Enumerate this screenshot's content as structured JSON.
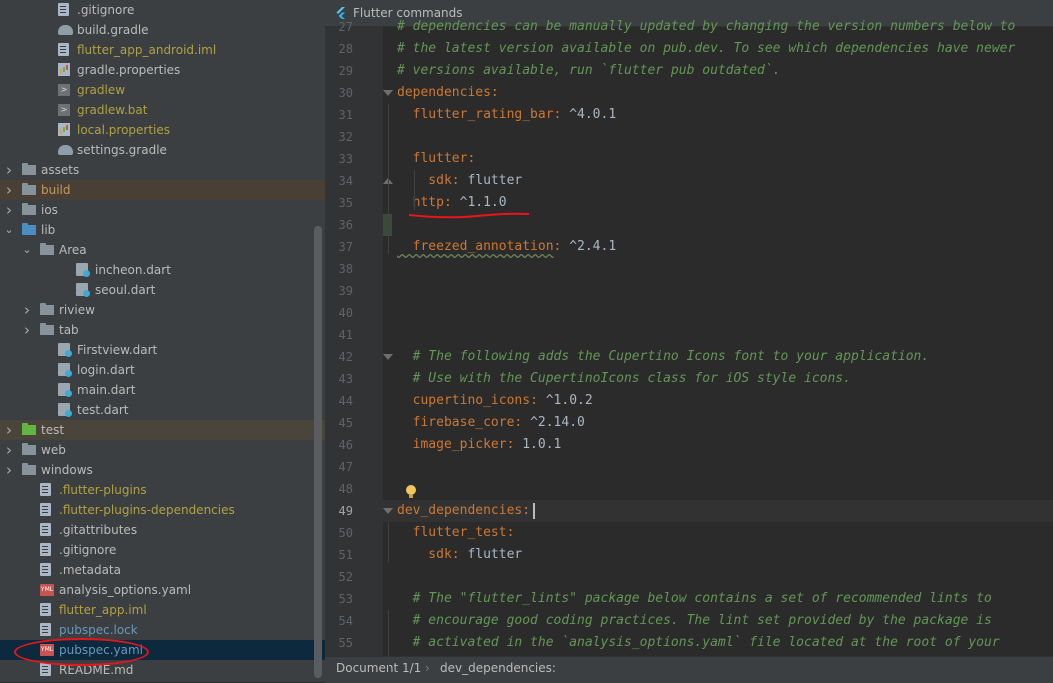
{
  "tree": {
    "items": [
      {
        "label": ".gitignore",
        "color": "def",
        "icon": "gitignore-file-icon",
        "depth": 2
      },
      {
        "label": "build.gradle",
        "color": "def",
        "icon": "gradle-icon",
        "depth": 2
      },
      {
        "label": "flutter_app_android.iml",
        "color": "yel",
        "icon": "module-file-icon",
        "depth": 2
      },
      {
        "label": "gradle.properties",
        "color": "def",
        "icon": "properties-icon",
        "depth": 2
      },
      {
        "label": "gradlew",
        "color": "yel",
        "icon": "shell-script-icon",
        "depth": 2
      },
      {
        "label": "gradlew.bat",
        "color": "yel",
        "icon": "batch-file-icon",
        "depth": 2
      },
      {
        "label": "local.properties",
        "color": "yel",
        "icon": "properties-icon",
        "depth": 2
      },
      {
        "label": "settings.gradle",
        "color": "def",
        "icon": "gradle-icon",
        "depth": 2
      },
      {
        "label": "assets",
        "color": "def",
        "icon": "folder-icon",
        "depth": 0,
        "arrow": "collapsed"
      },
      {
        "label": "build",
        "color": "gold",
        "icon": "folder-icon",
        "depth": 0,
        "arrow": "collapsed",
        "row": "build"
      },
      {
        "label": "ios",
        "color": "def",
        "icon": "folder-icon",
        "depth": 0,
        "arrow": "collapsed"
      },
      {
        "label": "lib",
        "color": "def",
        "icon": "source-folder-icon",
        "depth": 0,
        "arrow": "expanded"
      },
      {
        "label": "Area",
        "color": "def",
        "icon": "folder-icon",
        "depth": 1,
        "arrow": "expanded"
      },
      {
        "label": "incheon.dart",
        "color": "def",
        "icon": "dart-file-icon",
        "depth": 3
      },
      {
        "label": "seoul.dart",
        "color": "def",
        "icon": "dart-file-icon",
        "depth": 3
      },
      {
        "label": "riview",
        "color": "def",
        "icon": "folder-icon",
        "depth": 1,
        "arrow": "collapsed"
      },
      {
        "label": "tab",
        "color": "def",
        "icon": "folder-icon",
        "depth": 1,
        "arrow": "collapsed"
      },
      {
        "label": "Firstview.dart",
        "color": "def",
        "icon": "dart-file-icon",
        "depth": 2
      },
      {
        "label": "login.dart",
        "color": "def",
        "icon": "dart-file-icon",
        "depth": 2
      },
      {
        "label": "main.dart",
        "color": "def",
        "icon": "dart-file-icon",
        "depth": 2
      },
      {
        "label": "test.dart",
        "color": "def",
        "icon": "dart-file-icon",
        "depth": 2
      },
      {
        "label": "test",
        "color": "def",
        "icon": "test-folder-icon",
        "depth": 0,
        "arrow": "collapsed",
        "row": "test"
      },
      {
        "label": "web",
        "color": "def",
        "icon": "folder-icon",
        "depth": 0,
        "arrow": "collapsed"
      },
      {
        "label": "windows",
        "color": "def",
        "icon": "folder-icon",
        "depth": 0,
        "arrow": "collapsed"
      },
      {
        "label": ".flutter-plugins",
        "color": "yel",
        "icon": "text-file-icon",
        "depth": 1
      },
      {
        "label": ".flutter-plugins-dependencies",
        "color": "yel",
        "icon": "text-file-icon",
        "depth": 1
      },
      {
        "label": ".gitattributes",
        "color": "def",
        "icon": "text-file-icon",
        "depth": 1
      },
      {
        "label": ".gitignore",
        "color": "def",
        "icon": "gitignore-file-icon",
        "depth": 1
      },
      {
        "label": ".metadata",
        "color": "def",
        "icon": "text-file-icon",
        "depth": 1
      },
      {
        "label": "analysis_options.yaml",
        "color": "def",
        "icon": "yaml-file-icon",
        "depth": 1
      },
      {
        "label": "flutter_app.iml",
        "color": "yel",
        "icon": "module-file-icon",
        "depth": 1
      },
      {
        "label": "pubspec.lock",
        "color": "blu",
        "icon": "text-file-icon",
        "depth": 1
      },
      {
        "label": "pubspec.yaml",
        "color": "blu",
        "icon": "yaml-file-icon",
        "depth": 1,
        "row": "selected"
      },
      {
        "label": "README.md",
        "color": "def",
        "icon": "markdown-file-icon",
        "depth": 1
      }
    ]
  },
  "editor": {
    "tab_label": "Flutter commands",
    "lines": [
      {
        "n": "27",
        "parts": [
          {
            "t": "# dependencies can be manually updated by changing the version numbers below to",
            "c": "cm"
          }
        ]
      },
      {
        "n": "28",
        "parts": [
          {
            "t": "# the latest version available on pub.dev. To see which dependencies have newer",
            "c": "cm"
          }
        ]
      },
      {
        "n": "29",
        "parts": [
          {
            "t": "# versions available, run `flutter pub outdated`.",
            "c": "cm"
          }
        ]
      },
      {
        "n": "30",
        "parts": [
          {
            "t": "dependencies",
            "c": "key"
          },
          {
            "t": ":",
            "c": "colon"
          }
        ]
      },
      {
        "n": "31",
        "parts": [
          {
            "t": "  flutter_rating_bar",
            "c": "key"
          },
          {
            "t": ": ",
            "c": "colon"
          },
          {
            "t": "^4.0.1",
            "c": "val"
          }
        ]
      },
      {
        "n": "32",
        "parts": []
      },
      {
        "n": "33",
        "parts": [
          {
            "t": "  flutter",
            "c": "key"
          },
          {
            "t": ":",
            "c": "colon"
          }
        ]
      },
      {
        "n": "34",
        "parts": [
          {
            "t": "    sdk",
            "c": "key"
          },
          {
            "t": ": ",
            "c": "colon"
          },
          {
            "t": "flutter",
            "c": "val"
          }
        ]
      },
      {
        "n": "35",
        "parts": [
          {
            "t": "  http",
            "c": "key"
          },
          {
            "t": ": ",
            "c": "colon"
          },
          {
            "t": "^1.1.0",
            "c": "val"
          }
        ]
      },
      {
        "n": "36",
        "parts": []
      },
      {
        "n": "37",
        "parts": [
          {
            "t": "  freezed_annotation",
            "c": "key squig"
          },
          {
            "t": ": ",
            "c": "colon"
          },
          {
            "t": "^2.4.1",
            "c": "val"
          }
        ]
      },
      {
        "n": "38",
        "parts": []
      },
      {
        "n": "39",
        "parts": []
      },
      {
        "n": "40",
        "parts": []
      },
      {
        "n": "41",
        "parts": []
      },
      {
        "n": "42",
        "parts": [
          {
            "t": "  # The following adds the Cupertino Icons font to your application.",
            "c": "cm"
          }
        ]
      },
      {
        "n": "43",
        "parts": [
          {
            "t": "  # Use with the CupertinoIcons class for iOS style icons.",
            "c": "cm"
          }
        ]
      },
      {
        "n": "44",
        "parts": [
          {
            "t": "  cupertino_icons",
            "c": "key"
          },
          {
            "t": ": ",
            "c": "colon"
          },
          {
            "t": "^1.0.2",
            "c": "val"
          }
        ]
      },
      {
        "n": "45",
        "parts": [
          {
            "t": "  firebase_core",
            "c": "key"
          },
          {
            "t": ": ",
            "c": "colon"
          },
          {
            "t": "^2.14.0",
            "c": "val"
          }
        ]
      },
      {
        "n": "46",
        "parts": [
          {
            "t": "  image_picker",
            "c": "key"
          },
          {
            "t": ": ",
            "c": "colon"
          },
          {
            "t": "1.0.1",
            "c": "val"
          }
        ]
      },
      {
        "n": "47",
        "parts": []
      },
      {
        "n": "48",
        "parts": []
      },
      {
        "n": "49",
        "parts": [
          {
            "t": "dev_dependencies",
            "c": "key"
          },
          {
            "t": ":",
            "c": "colon"
          }
        ],
        "current": true
      },
      {
        "n": "50",
        "parts": [
          {
            "t": "  flutter_test",
            "c": "key"
          },
          {
            "t": ":",
            "c": "colon"
          }
        ]
      },
      {
        "n": "51",
        "parts": [
          {
            "t": "    sdk",
            "c": "key"
          },
          {
            "t": ": ",
            "c": "colon"
          },
          {
            "t": "flutter",
            "c": "val"
          }
        ]
      },
      {
        "n": "52",
        "parts": []
      },
      {
        "n": "53",
        "parts": [
          {
            "t": "  # The \"flutter_lints\" package below contains a set of recommended lints to",
            "c": "cm"
          }
        ]
      },
      {
        "n": "54",
        "parts": [
          {
            "t": "  # encourage good coding practices. The lint set provided by the package is",
            "c": "cm"
          }
        ]
      },
      {
        "n": "55",
        "parts": [
          {
            "t": "  # activated in the `analysis_options.yaml` file located at the root of your",
            "c": "cm"
          }
        ]
      }
    ]
  },
  "status": {
    "document": "Document 1/1",
    "separator": "›",
    "breadcrumb": "dev_dependencies:"
  },
  "colors": {
    "accent_annotation": "#e8151b",
    "selection": "#0d293e"
  }
}
